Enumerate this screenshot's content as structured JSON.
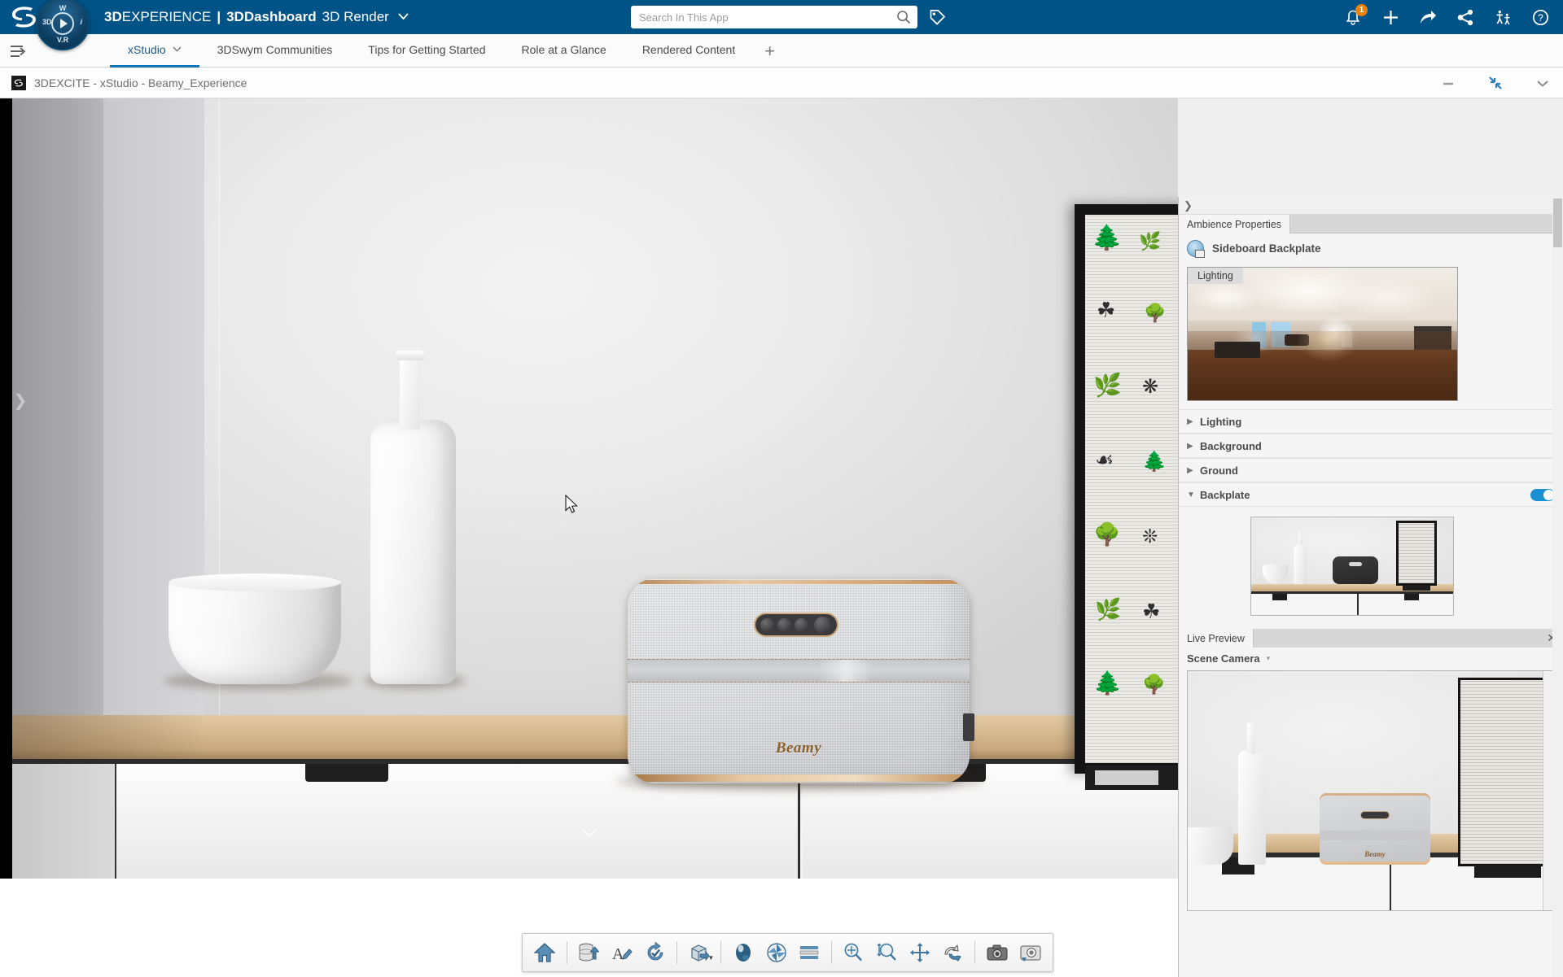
{
  "topbar": {
    "brand_1": "3D",
    "brand_1b": "EXPERIENCE",
    "separator": "|",
    "brand_2": "3DDashboard",
    "brand_3": "3D Render",
    "caret": "⌄",
    "compass": {
      "north": "W",
      "west": "3D",
      "east": "i",
      "south": "V.R"
    },
    "search": {
      "value": "",
      "placeholder": "Search In This App"
    },
    "icons": {
      "search": "search-icon",
      "tag": "tag-icon",
      "notifications": "bell-icon",
      "notifications_badge": "1",
      "add": "plus-icon",
      "share_arrow": "share-arrow-icon",
      "share_nodes": "share-nodes-icon",
      "collaborate": "3dswym-people-icon",
      "help": "help-icon"
    }
  },
  "tabbar": {
    "menu_icon": "hamburger-menu-icon",
    "tabs": [
      {
        "label": "xStudio",
        "active": true,
        "has_caret": true
      },
      {
        "label": "3DSwym Communities",
        "active": false,
        "has_caret": false
      },
      {
        "label": "Tips for Getting Started",
        "active": false,
        "has_caret": false
      },
      {
        "label": "Role at a Glance",
        "active": false,
        "has_caret": false
      },
      {
        "label": "Rendered Content",
        "active": false,
        "has_caret": false
      }
    ],
    "add_tab": "+"
  },
  "apptitle": {
    "icon": "3ds-app-icon",
    "prefix": "3DEXCITE",
    "dash1": "-",
    "app": "xStudio",
    "dash2": "-",
    "document": "Beamy_Experience",
    "full": "3DEXCITE - xStudio - Beamy_Experience",
    "controls": {
      "minimize": "minimize-icon",
      "restore": "restore-down-icon",
      "more": "chevron-down-icon"
    }
  },
  "viewport": {
    "expander_left": "❯",
    "expander_bottom": "⌄",
    "cursor": "mouse-pointer",
    "scene_name": "Beamy speaker on sideboard",
    "product_logo": "Beamy"
  },
  "toolbar": {
    "buttons": [
      {
        "name": "home",
        "label": "Home"
      },
      {
        "name": "save-to-database",
        "label": "Save"
      },
      {
        "name": "annotate-text",
        "label": "Annotate"
      },
      {
        "name": "update-refresh",
        "label": "Update"
      },
      {
        "name": "import-model",
        "label": "Import",
        "has_caret": true
      },
      {
        "name": "material-sphere",
        "label": "Materials"
      },
      {
        "name": "aperture-render",
        "label": "Render Settings"
      },
      {
        "name": "layers-list",
        "label": "Layers"
      },
      {
        "name": "zoom-fit",
        "label": "Zoom Fit"
      },
      {
        "name": "zoom-area",
        "label": "Zoom Area"
      },
      {
        "name": "pan",
        "label": "Pan"
      },
      {
        "name": "rotate-manipulate",
        "label": "Rotate"
      },
      {
        "name": "camera",
        "label": "Camera"
      },
      {
        "name": "snapshot",
        "label": "Snapshot"
      }
    ]
  },
  "rightpanel": {
    "collapse_icon": "❯",
    "tab": "Ambience Properties",
    "header": {
      "icon": "ambience-icon",
      "title": "Sideboard Backplate"
    },
    "hdri": {
      "label": "Lighting",
      "alt": "HDRI loft interior panorama"
    },
    "sections": [
      {
        "label": "Lighting",
        "expanded": false,
        "toggle": null
      },
      {
        "label": "Background",
        "expanded": false,
        "toggle": null
      },
      {
        "label": "Ground",
        "expanded": false,
        "toggle": null
      },
      {
        "label": "Backplate",
        "expanded": true,
        "toggle": true
      }
    ],
    "backplate_thumb_alt": "Sideboard backplate photograph",
    "live_preview": {
      "tab": "Live Preview",
      "close": "✕",
      "camera": "Scene Camera",
      "camera_caret": "▾",
      "image_alt": "Live render preview of Beamy speaker on sideboard"
    }
  }
}
